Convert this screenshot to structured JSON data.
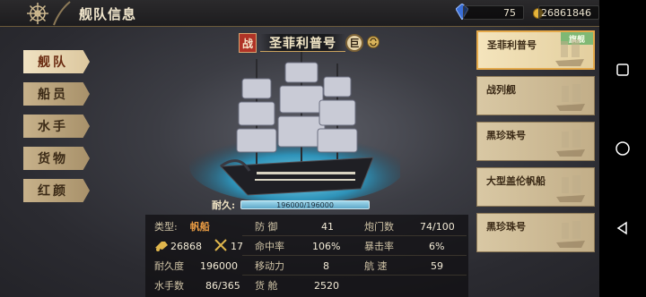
{
  "header": {
    "title": "舰队信息"
  },
  "resources": {
    "gems": "75",
    "gold": "26861846"
  },
  "menu": {
    "items": [
      {
        "label": "舰队"
      },
      {
        "label": "船员"
      },
      {
        "label": "水手"
      },
      {
        "label": "货物"
      },
      {
        "label": "红颜"
      }
    ]
  },
  "ship": {
    "badge": "战",
    "name": "圣菲利普号",
    "rank": "巨",
    "durability_label": "耐久:",
    "durability_value": "196000/196000",
    "durability_fraction": 1.0
  },
  "stats": {
    "type_label": "类型:",
    "type_value": "帆船",
    "attack_value": "26868",
    "cannons_icon_value": "17",
    "durability_label": "耐久度",
    "durability_value": "196000",
    "sailors_label": "水手数",
    "sailors_value": "86/365",
    "defense_label": "防 御",
    "defense_value": "41",
    "hit_label": "命中率",
    "hit_value": "106%",
    "mobility_label": "移动力",
    "mobility_value": "8",
    "cargo_label": "货 舱",
    "cargo_value": "2520",
    "guns_label": "炮门数",
    "guns_value": "74/100",
    "crit_label": "暴击率",
    "crit_value": "6%",
    "speed_label": "航 速",
    "speed_value": "59"
  },
  "fleet": {
    "flag_tag": "旗舰",
    "ships": [
      {
        "name": "圣菲利普号"
      },
      {
        "name": "战列舰"
      },
      {
        "name": "黑珍珠号"
      },
      {
        "name": "大型盖伦帆船"
      },
      {
        "name": "黑珍珠号"
      }
    ]
  },
  "colors": {
    "accent_orange": "#e79a43",
    "menu_active": "#f0e2c2",
    "water": "#37a3c8"
  }
}
